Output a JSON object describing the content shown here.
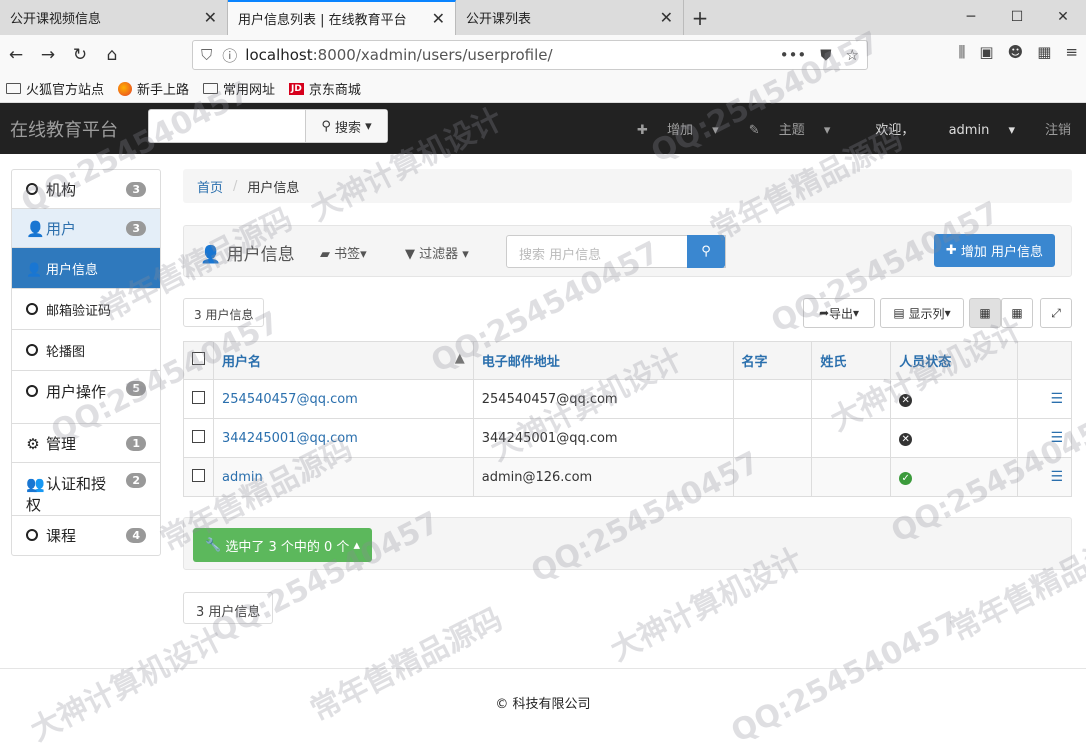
{
  "browser": {
    "tabs": [
      {
        "label": "公开课视频信息",
        "active": false
      },
      {
        "label": "用户信息列表 | 在线教育平台",
        "active": true
      },
      {
        "label": "公开课列表",
        "active": false
      }
    ],
    "url_host": "localhost",
    "url_path": ":8000/xadmin/users/userprofile/",
    "bookmarks": [
      "火狐官方站点",
      "新手上路",
      "常用网址",
      "京东商城"
    ]
  },
  "app": {
    "brand": "在线教育平台",
    "search_button": "搜索",
    "add_menu": "增加",
    "theme_menu": "主题",
    "welcome": "欢迎，",
    "user": "admin",
    "logout": "注销"
  },
  "sidebar": {
    "items": [
      {
        "label": "机构",
        "badge": "3"
      },
      {
        "label": "用户",
        "badge": "3"
      },
      {
        "label": "用户信息"
      },
      {
        "label": "邮箱验证码"
      },
      {
        "label": "轮播图"
      },
      {
        "label": "用户操作",
        "badge": "5"
      },
      {
        "label": "管理",
        "badge": "1"
      },
      {
        "label": "认证和授权",
        "badge": "2"
      },
      {
        "label": "课程",
        "badge": "4"
      }
    ]
  },
  "breadcrumb": {
    "home": "首页",
    "current": "用户信息"
  },
  "toolbar": {
    "title": "用户信息",
    "bookmarks": "书签",
    "filter": "过滤器",
    "search_placeholder": "搜索 用户信息",
    "add_button": "增加 用户信息"
  },
  "controls": {
    "count": "3 用户信息",
    "export": "导出",
    "columns": "显示列"
  },
  "table": {
    "headers": [
      "用户名",
      "电子邮件地址",
      "名字",
      "姓氏",
      "人员状态"
    ],
    "rows": [
      {
        "username": "254540457@qq.com",
        "email": "254540457@qq.com",
        "first": "",
        "last": "",
        "active": false
      },
      {
        "username": "344245001@qq.com",
        "email": "344245001@qq.com",
        "first": "",
        "last": "",
        "active": false
      },
      {
        "username": "admin",
        "email": "admin@126.com",
        "first": "",
        "last": "",
        "active": true
      }
    ]
  },
  "actions": {
    "selected": "选中了 3 个中的 0 个"
  },
  "footer_count": "3 用户信息",
  "footer": "© 科技有限公司",
  "watermarks": [
    "QQ:254540457",
    "大神计算机设计",
    "常年售精品源码"
  ]
}
